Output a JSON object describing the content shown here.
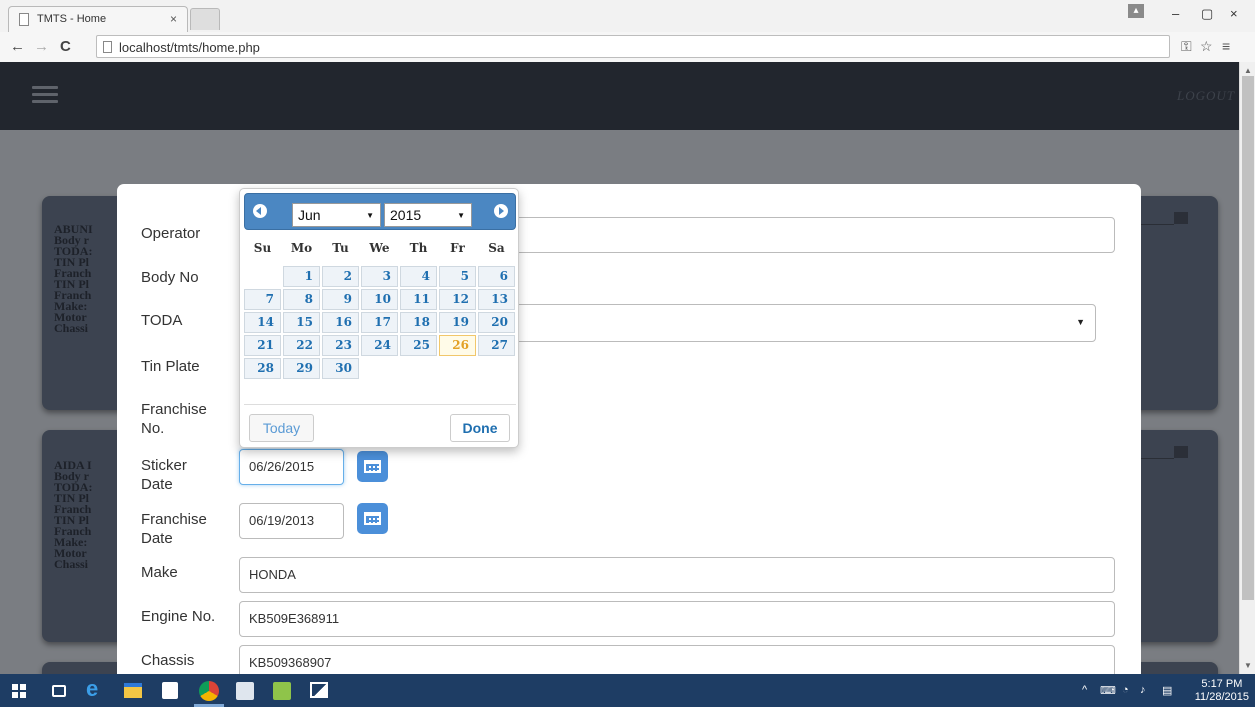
{
  "browser": {
    "tab_title": "TMTS - Home",
    "tab_close": "×",
    "url": "localhost/tmts/home.php",
    "back_icon": "←",
    "forward_icon": "→",
    "reload_icon": "C",
    "win_minimize": "–",
    "win_maximize": "▢",
    "win_close": "×"
  },
  "app": {
    "logout_label": "LOGOUT"
  },
  "background_cards": [
    {
      "lines": [
        "ABUNI",
        "Body r",
        "TODA:",
        "TIN Pl",
        "Franch",
        "TIN Pl",
        "Franch",
        "Make:",
        "Motor",
        "Chassi"
      ]
    },
    {
      "lines": [
        "AIDA I",
        "Body r",
        "TODA:",
        "TIN Pl",
        "Franch",
        "TIN Pl",
        "Franch",
        "Make:",
        "Motor",
        "Chassi"
      ]
    }
  ],
  "form": {
    "operator_label": "Operator",
    "body_no_label": "Body No",
    "toda_label": "TODA",
    "tin_plate_label": "Tin Plate",
    "franchise_no_label_1": "Franchise",
    "franchise_no_label_2": "No.",
    "sticker_date_label_1": "Sticker",
    "sticker_date_label_2": "Date",
    "sticker_date_value": "06/26/2015",
    "franchise_date_label_1": "Franchise",
    "franchise_date_label_2": "Date",
    "franchise_date_value": "06/19/2013",
    "make_label": "Make",
    "make_value": "HONDA",
    "engine_no_label": "Engine No.",
    "engine_no_value": "KB509E368911",
    "chassis_label": "Chassis",
    "chassis_value": "KB509368907"
  },
  "datepicker": {
    "month": "Jun",
    "year": "2015",
    "weekdays": [
      "Su",
      "Mo",
      "Tu",
      "We",
      "Th",
      "Fr",
      "Sa"
    ],
    "days": [
      "1",
      "2",
      "3",
      "4",
      "5",
      "6",
      "7",
      "8",
      "9",
      "10",
      "11",
      "12",
      "13",
      "14",
      "15",
      "16",
      "17",
      "18",
      "19",
      "20",
      "21",
      "22",
      "23",
      "24",
      "25",
      "26",
      "27",
      "28",
      "29",
      "30"
    ],
    "selected_day": "26",
    "today_label": "Today",
    "done_label": "Done"
  },
  "taskbar": {
    "time": "5:17 PM",
    "date": "11/28/2015",
    "tray_up": "^"
  },
  "colors": {
    "page_header": "#22262e",
    "card_bg": "#3c4350",
    "datepicker_header": "#4b87c2",
    "calendar_button": "#4b8fd9",
    "day_link": "#1f6fb0",
    "highlight_day": "#e3a126",
    "taskbar": "#1e3d64"
  }
}
